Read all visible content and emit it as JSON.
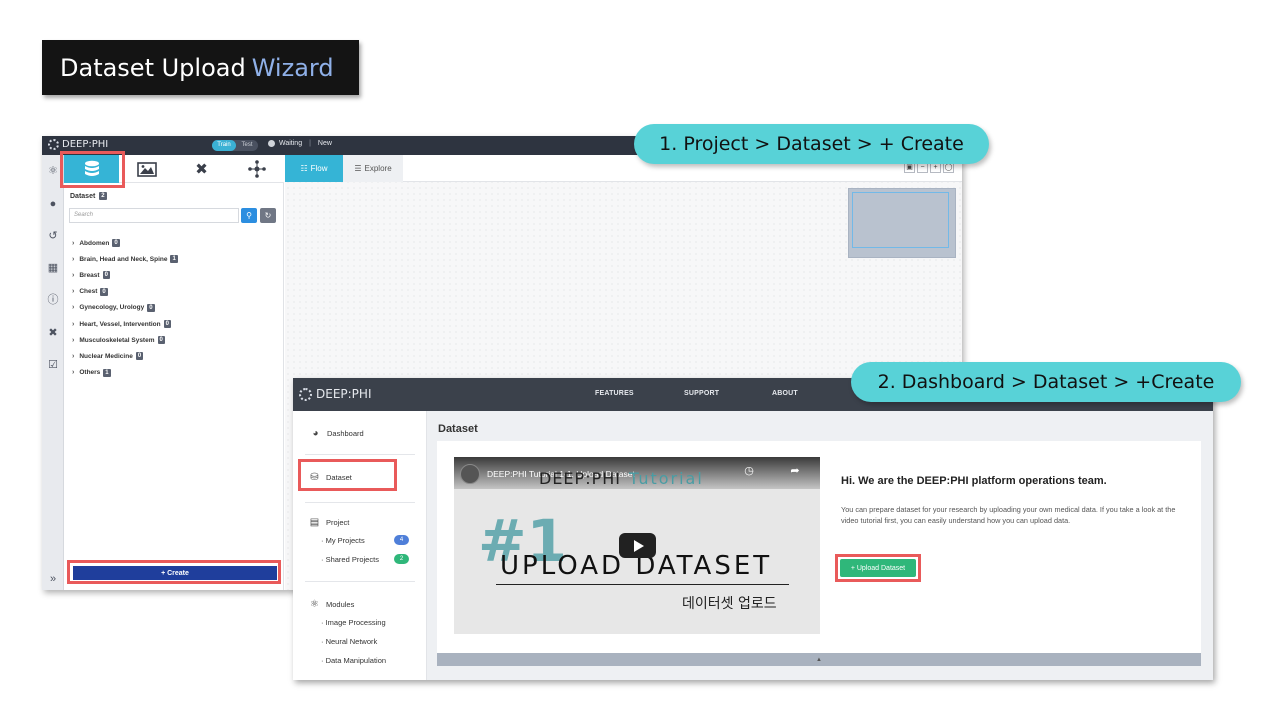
{
  "slide": {
    "title_main": "Dataset Upload",
    "title_accent": "Wizard",
    "callout1": "1. Project > Dataset > + Create",
    "callout2": "2. Dashboard > Dataset > +Create",
    "highlight_color": "#e95a5a",
    "callout_color": "#58d2d7"
  },
  "project_view": {
    "logo": "DEEP:PHI",
    "mode_toggle": {
      "train": "Train",
      "test": "Test",
      "selected": "Train"
    },
    "status": "Waiting",
    "project_name": "New",
    "rail_icons": [
      "modules-icon",
      "user-icon",
      "history-icon",
      "file-add-icon",
      "info-icon",
      "tools-icon",
      "checklist-icon"
    ],
    "collapse_glyph": "»",
    "panel_tabs": [
      {
        "icon": "database-icon",
        "active": true
      },
      {
        "icon": "image-icon",
        "active": false
      },
      {
        "icon": "tools-icon",
        "active": false
      },
      {
        "icon": "network-icon",
        "active": false
      }
    ],
    "dataset_header": "Dataset",
    "dataset_count": "2",
    "search_placeholder": "Search",
    "tree": [
      {
        "label": "Abdomen",
        "count": "0"
      },
      {
        "label": "Brain, Head and Neck, Spine",
        "count": "1"
      },
      {
        "label": "Breast",
        "count": "0"
      },
      {
        "label": "Chest",
        "count": "0"
      },
      {
        "label": "Gynecology, Urology",
        "count": "0"
      },
      {
        "label": "Heart, Vessel, Intervention",
        "count": "0"
      },
      {
        "label": "Musculoskeletal System",
        "count": "0"
      },
      {
        "label": "Nuclear Medicine",
        "count": "0"
      },
      {
        "label": "Others",
        "count": "1"
      }
    ],
    "create_label": "+ Create",
    "canvas_tabs": {
      "flow": "Flow",
      "explore": "Explore"
    },
    "accent": "#35b4d6",
    "create_color": "#1f3e9c"
  },
  "dashboard_view": {
    "logo": "DEEP:PHI",
    "nav": [
      "FEATURES",
      "SUPPORT",
      "ABOUT"
    ],
    "sidebar": {
      "dashboard": "Dashboard",
      "dataset": "Dataset",
      "project": "Project",
      "my_projects": "· My Projects",
      "my_projects_count": "4",
      "shared_projects": "· Shared Projects",
      "shared_projects_count": "2",
      "modules": "Modules",
      "module_items": [
        "· Image Processing",
        "· Neural Network",
        "· Data Manipulation"
      ]
    },
    "page_title": "Dataset",
    "video": {
      "title": "DEEP:PHI Tutorial 1-1. Upload Dataset",
      "brand": "DEEP:PHI",
      "brand_suffix": "Tutorial",
      "number": "#1",
      "headline": "UPLOAD DATASET",
      "subtitle_kr": "데이터셋 업로드"
    },
    "greeting": "Hi. We are the DEEP:PHI platform operations team.",
    "description": "You can prepare dataset for your research by uploading your own medical data. If you take a look at the video tutorial first, you can easily understand how you can upload data.",
    "upload_button": "+ Upload Dataset",
    "upload_color": "#2fb77a"
  }
}
